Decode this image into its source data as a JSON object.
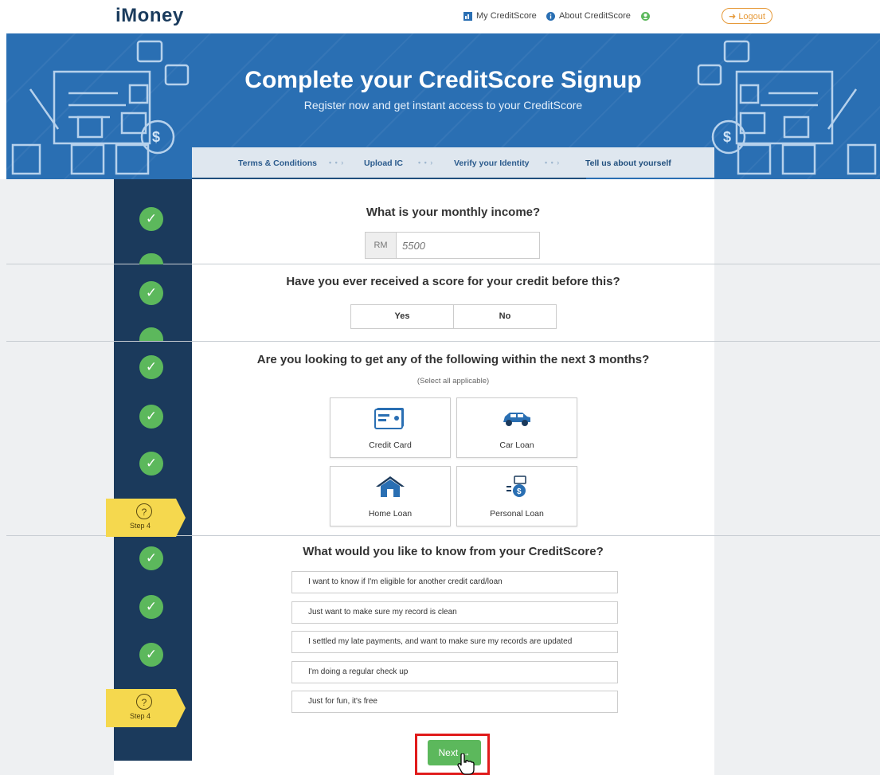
{
  "brand": {
    "logo": "iMoney"
  },
  "topnav": {
    "my_creditscore": "My CreditScore",
    "about_creditscore": "About CreditScore",
    "logout": "Logout"
  },
  "banner": {
    "title": "Complete your CreditScore Signup",
    "subtitle": "Register now and get instant access to your CreditScore"
  },
  "steps": [
    {
      "label": "Terms & Conditions"
    },
    {
      "label": "Upload IC"
    },
    {
      "label": "Verify your Identity"
    },
    {
      "label": "Tell us about yourself"
    }
  ],
  "step_marker": "Step 4",
  "income": {
    "question": "What is your monthly income?",
    "prefix": "RM",
    "placeholder": "5500"
  },
  "prior_score": {
    "question": "Have you ever received a score for your credit before this?",
    "yes": "Yes",
    "no": "No"
  },
  "loans": {
    "question": "Are you looking to get any of the following within the next 3 months?",
    "hint": "(Select all applicable)",
    "options": [
      "Credit Card",
      "Car Loan",
      "Home Loan",
      "Personal Loan"
    ]
  },
  "reasons": {
    "question": "What would you like to know from your CreditScore?",
    "options": [
      "I want to know if I'm eligible for another credit card/loan",
      "Just want to make sure my record is clean",
      "I settled my late payments, and want to make sure my records are updated",
      "I'm doing a regular check up",
      "Just for fun, it's free"
    ]
  },
  "next_button": "Next →",
  "colors": {
    "brand_blue": "#2a6fb3",
    "rail": "#1b3a5c",
    "success": "#5cb85c",
    "step_marker": "#f5d84e",
    "highlight": "#e01b1b"
  }
}
